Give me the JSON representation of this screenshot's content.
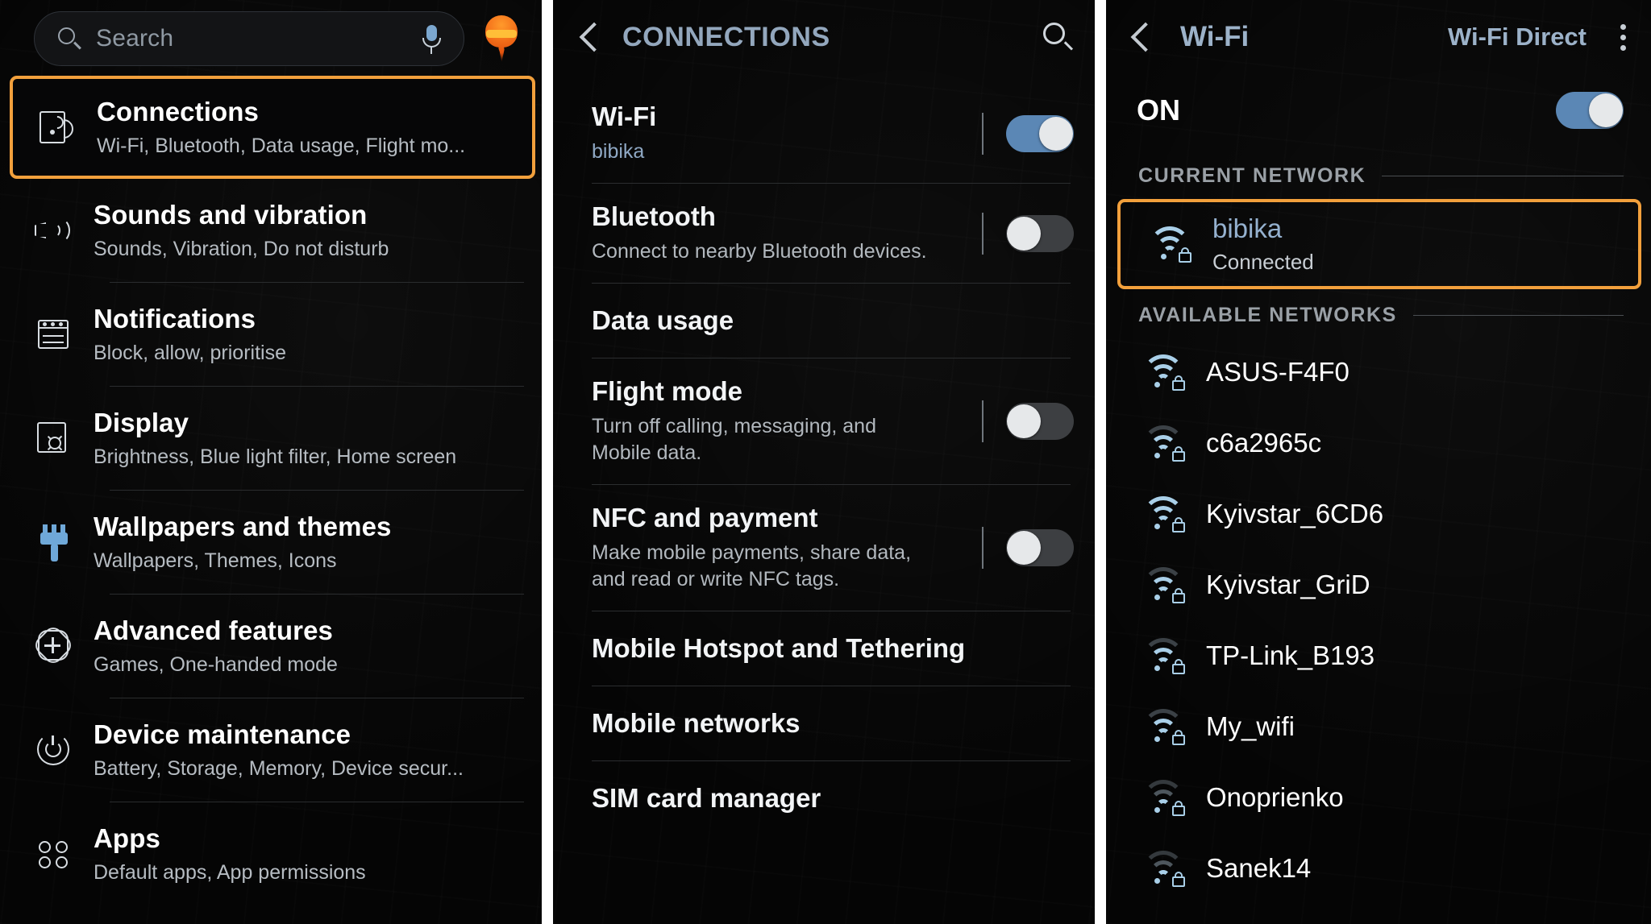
{
  "colors": {
    "highlight": "#f2a03c",
    "accent_blue": "#93a7bd",
    "toggle_on": "#5b87b5",
    "wifi_icon": "#a9cfe8"
  },
  "panel1": {
    "search": {
      "placeholder": "Search",
      "value": "",
      "icon": "search-icon",
      "mic_icon": "microphone-icon"
    },
    "avatar_icon": "flame-avatar-icon",
    "items": [
      {
        "icon": "connections-icon",
        "title": "Connections",
        "subtitle": "Wi-Fi, Bluetooth, Data usage, Flight mo...",
        "selected": true
      },
      {
        "icon": "sound-icon",
        "title": "Sounds and vibration",
        "subtitle": "Sounds, Vibration, Do not disturb",
        "selected": false
      },
      {
        "icon": "notifications-icon",
        "title": "Notifications",
        "subtitle": "Block, allow, prioritise",
        "selected": false
      },
      {
        "icon": "display-icon",
        "title": "Display",
        "subtitle": "Brightness, Blue light filter, Home screen",
        "selected": false
      },
      {
        "icon": "paintbrush-icon",
        "title": "Wallpapers and themes",
        "subtitle": "Wallpapers, Themes, Icons",
        "selected": false
      },
      {
        "icon": "advanced-features-icon",
        "title": "Advanced features",
        "subtitle": "Games, One-handed mode",
        "selected": false
      },
      {
        "icon": "device-maintenance-icon",
        "title": "Device maintenance",
        "subtitle": "Battery, Storage, Memory, Device secur...",
        "selected": false
      },
      {
        "icon": "apps-grid-icon",
        "title": "Apps",
        "subtitle": "Default apps, App permissions",
        "selected": false
      }
    ]
  },
  "panel2": {
    "header": {
      "back_icon": "back-chevron-icon",
      "title": "CONNECTIONS",
      "search_icon": "search-icon"
    },
    "rows": [
      {
        "title": "Wi-Fi",
        "subtitle": "bibika",
        "subtitle_style": "link",
        "toggle": "on"
      },
      {
        "title": "Bluetooth",
        "subtitle": "Connect to nearby Bluetooth devices.",
        "subtitle_style": "normal",
        "toggle": "off"
      },
      {
        "title": "Data usage",
        "subtitle": "",
        "subtitle_style": "normal",
        "toggle": "none"
      },
      {
        "title": "Flight mode",
        "subtitle": "Turn off calling, messaging, and Mobile data.",
        "subtitle_style": "normal",
        "toggle": "off"
      },
      {
        "title": "NFC and payment",
        "subtitle": "Make mobile payments, share data, and read or write NFC tags.",
        "subtitle_style": "normal",
        "toggle": "off"
      },
      {
        "title": "Mobile Hotspot and Tethering",
        "subtitle": "",
        "subtitle_style": "normal",
        "toggle": "none"
      },
      {
        "title": "Mobile networks",
        "subtitle": "",
        "subtitle_style": "normal",
        "toggle": "none"
      },
      {
        "title": "SIM card manager",
        "subtitle": "",
        "subtitle_style": "normal",
        "toggle": "none"
      }
    ]
  },
  "panel3": {
    "header": {
      "back_icon": "back-chevron-icon",
      "title": "Wi-Fi",
      "direct_label": "Wi-Fi Direct",
      "menu_icon": "kebab-menu-icon"
    },
    "power": {
      "label": "ON",
      "toggle": "on"
    },
    "current_network_header": "CURRENT NETWORK",
    "current_network": {
      "ssid": "bibika",
      "state": "Connected",
      "icon": "wifi-lock-icon",
      "signal": 3
    },
    "available_header": "AVAILABLE NETWORKS",
    "available_networks": [
      {
        "ssid": "ASUS-F4F0",
        "icon": "wifi-lock-icon",
        "signal": 3
      },
      {
        "ssid": "c6a2965c",
        "icon": "wifi-lock-icon",
        "signal": 2
      },
      {
        "ssid": "Kyivstar_6CD6",
        "icon": "wifi-lock-icon",
        "signal": 3
      },
      {
        "ssid": "Kyivstar_GriD",
        "icon": "wifi-lock-icon",
        "signal": 2
      },
      {
        "ssid": "TP-Link_B193",
        "icon": "wifi-lock-icon",
        "signal": 2
      },
      {
        "ssid": "My_wifi",
        "icon": "wifi-lock-icon",
        "signal": 2
      },
      {
        "ssid": "Onoprienko",
        "icon": "wifi-lock-icon",
        "signal": 1
      },
      {
        "ssid": "Sanek14",
        "icon": "wifi-lock-icon",
        "signal": 1
      }
    ]
  }
}
